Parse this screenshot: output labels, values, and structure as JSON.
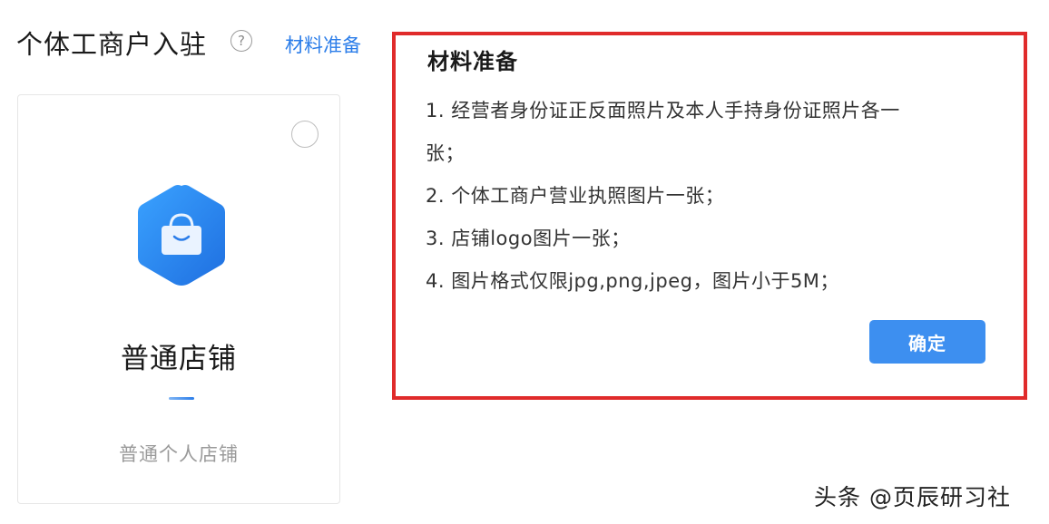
{
  "header": {
    "title": "个体工商户入驻",
    "help_icon_glyph": "?",
    "materials_link": "材料准备"
  },
  "store_card": {
    "icon": "shopping-bag-hexagon-icon",
    "title": "普通店铺",
    "description": "普通个人店铺",
    "selected": false
  },
  "popup": {
    "title": "材料准备",
    "items": [
      "1. 经营者身份证正反面照片及本人手持身份证照片各一",
      "张；",
      "2. 个体工商户营业执照图片一张；",
      "3. 店铺logo图片一张；",
      "4. 图片格式仅限jpg,png,jpeg，图片小于5M；"
    ],
    "confirm_label": "确定"
  },
  "watermark": "头条 @页辰研习社",
  "colors": {
    "accent": "#2b7de9",
    "button": "#3d8ff0",
    "highlight_border": "#e02b2b"
  }
}
